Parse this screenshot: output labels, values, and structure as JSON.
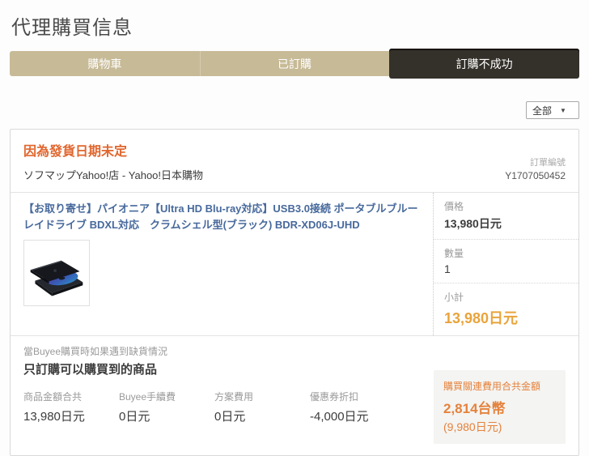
{
  "page": {
    "title": "代理購買信息"
  },
  "tabs": [
    {
      "label": "購物車",
      "active": false
    },
    {
      "label": "已訂購",
      "active": false
    },
    {
      "label": "訂購不成功",
      "active": true
    }
  ],
  "filter": {
    "selected": "全部",
    "caret": "▼"
  },
  "order": {
    "status_message": "因為發貨日期未定",
    "store": "ソフマップYahoo!店 - Yahoo!日本購物",
    "order_number_label": "訂單編號",
    "order_number": "Y1707050452",
    "item": {
      "title": "【お取り寄せ】パイオニア【Ultra HD Blu-ray対応】USB3.0接続 ポータブルブルーレイドライブ BDXL対応　クラムシェル型(ブラック) BDR-XD06J-UHD",
      "price_label": "價格",
      "price": "13,980日元",
      "qty_label": "數量",
      "qty": "1",
      "subtotal_label": "小計",
      "subtotal": "13,980日元"
    },
    "availability_note_label": "當Buyee購買時如果遇到缺貨情況",
    "availability_note": "只訂購可以購買到的商品",
    "totals": [
      {
        "label": "商品金額合共",
        "value": "13,980日元"
      },
      {
        "label": "Buyee手續費",
        "value": "0日元"
      },
      {
        "label": "方案費用",
        "value": "0日元"
      },
      {
        "label": "優惠券折扣",
        "value": "-4,000日元"
      }
    ],
    "summary": {
      "label": "購買關連費用合共金額",
      "amount": "2,814台幣",
      "amount_jpy": "(9,980日元)"
    }
  },
  "colors": {
    "tab_inactive": "#c7ba97",
    "tab_active": "#34302a",
    "status_orange": "#e1662e",
    "subtotal_amber": "#e9a43c",
    "summary_orange": "#e5823c",
    "link_blue": "#47699c"
  }
}
